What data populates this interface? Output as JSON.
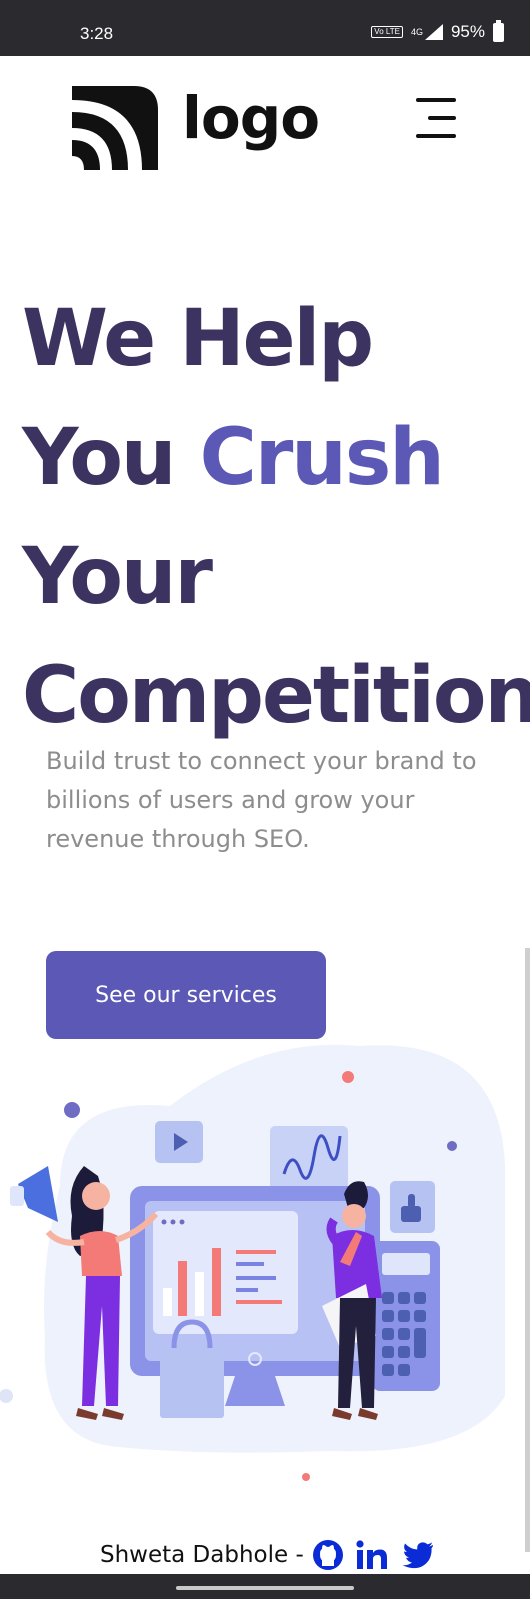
{
  "status_bar": {
    "time": "3:28",
    "volte": "Vo LTE",
    "network": "4G",
    "battery": "95%"
  },
  "header": {
    "logo_text": "logo",
    "menu_icon": "hamburger-menu-icon"
  },
  "hero": {
    "headline_line1": "We Help",
    "headline_line2_a": "You ",
    "headline_line2_accent": "Crush",
    "headline_line3": "Your",
    "headline_line4": "Competition",
    "subtext": "Build trust to connect your brand to billions of users and grow your revenue through SEO.",
    "cta_label": "See our services"
  },
  "footer": {
    "credit": "Shweta Dabhole -",
    "icons": [
      "github-icon",
      "linkedin-icon",
      "twitter-icon"
    ]
  },
  "colors": {
    "headline": "#3d3361",
    "accent": "#5c58b5",
    "subtext": "#8d8d8d",
    "status_bar": "#2b2b2f",
    "link_blue": "#0a2bd6"
  }
}
